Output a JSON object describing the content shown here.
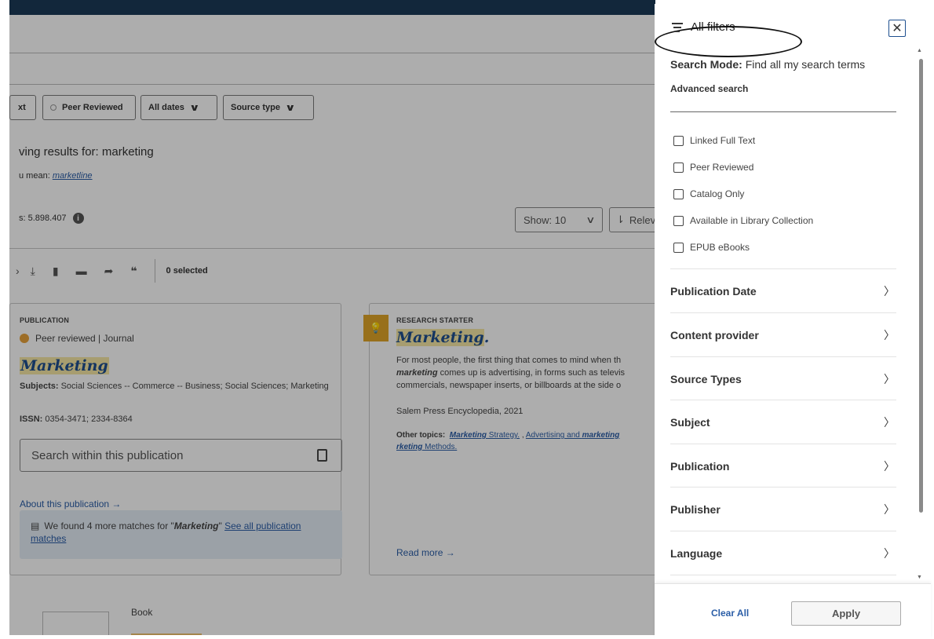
{
  "filters": {
    "pill_text": "xt",
    "peer_reviewed": "Peer Reviewed",
    "all_dates": "All dates",
    "source_type": "Source type"
  },
  "results": {
    "showing": "ving results for: marketing",
    "didyoumean_prefix": "u mean: ",
    "didyoumean_link": "marketline",
    "count": "s: 5.898.407",
    "show": "Show: 10",
    "sort": "Releva",
    "selected": "0 selected"
  },
  "card1": {
    "kind": "PUBLICATION",
    "badge": "Peer reviewed | Journal",
    "title": "Marketing",
    "subjects_label": "Subjects:",
    "subjects": "Social Sciences -- Commerce -- Business; Social Sciences; Marketing",
    "issn_label": "ISSN:",
    "issn": "0354-3471; 2334-8364",
    "search_within": "Search within this publication",
    "about": "About this publication →",
    "found_prefix": "We found 4 more matches for \"",
    "found_term": "Marketing",
    "found_suffix": "\" ",
    "found_link": "See all publication matches"
  },
  "card2": {
    "kind": "RESEARCH STARTER",
    "title": "Marketing",
    "title_suffix": ".",
    "snippet_1": "For most people, the first thing that comes to mind when th",
    "snippet_term": "marketing",
    "snippet_2": " comes up is advertising, in forms such as televis",
    "snippet_3": "commercials, newspaper inserts, or billboards at the side o",
    "source": "Salem Press Encyclopedia, 2021",
    "other_label": "Other topics:",
    "other_1a": "Marketing",
    "other_1b": " Strategy.",
    "other_sep": " , ",
    "other_2a": "Advertising and ",
    "other_2b": "marketing",
    "other_3a": "rketing",
    "other_3b": " Methods.",
    "readmore": "Read more →"
  },
  "book": {
    "label": "Book"
  },
  "panel": {
    "title": "All filters",
    "close": "✕",
    "mode_label": "Search Mode:",
    "mode_value": " Find all my search terms",
    "advanced": "Advanced search",
    "checkboxes": [
      "Linked Full Text",
      "Peer Reviewed",
      "Catalog Only",
      "Available in Library Collection",
      "EPUB eBooks"
    ],
    "facets": [
      "Publication Date",
      "Content provider",
      "Source Types",
      "Subject",
      "Publication",
      "Publisher",
      "Language"
    ],
    "clear": "Clear All",
    "apply": "Apply"
  },
  "colors": {
    "brand_dark": "#1b3a57",
    "link": "#2b5ea7",
    "highlight": "#f6e7a6",
    "accent": "#e0a628"
  }
}
